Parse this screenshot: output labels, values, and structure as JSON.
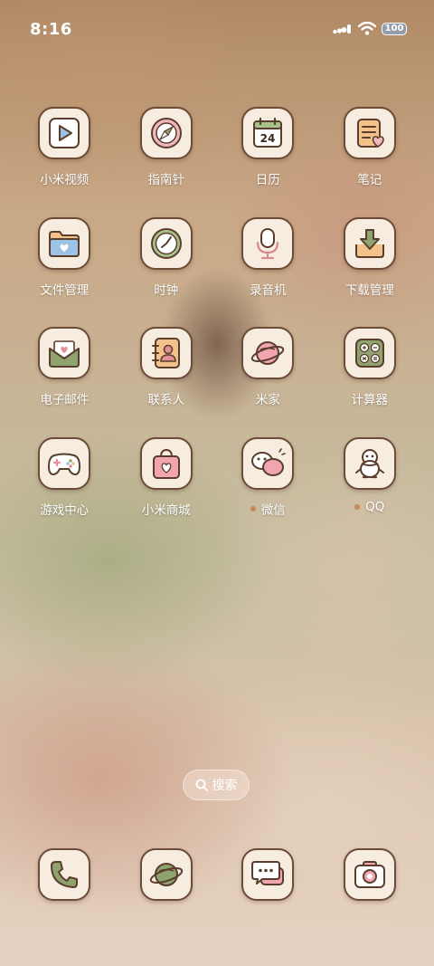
{
  "status_bar": {
    "time": "8:16",
    "signal_icon": "signal-bars-icon",
    "wifi_icon": "wifi-icon",
    "battery": "100"
  },
  "apps": [
    {
      "label": "小米视频",
      "icon": "video-play-icon"
    },
    {
      "label": "指南针",
      "icon": "compass-icon"
    },
    {
      "label": "日历",
      "icon": "calendar-icon",
      "day": "24"
    },
    {
      "label": "笔记",
      "icon": "notes-icon"
    },
    {
      "label": "文件管理",
      "icon": "folder-icon"
    },
    {
      "label": "时钟",
      "icon": "clock-icon"
    },
    {
      "label": "录音机",
      "icon": "microphone-icon"
    },
    {
      "label": "下载管理",
      "icon": "download-icon"
    },
    {
      "label": "电子邮件",
      "icon": "mail-icon"
    },
    {
      "label": "联系人",
      "icon": "contacts-icon"
    },
    {
      "label": "米家",
      "icon": "planet-icon"
    },
    {
      "label": "计算器",
      "icon": "calculator-icon"
    },
    {
      "label": "游戏中心",
      "icon": "gamepad-icon"
    },
    {
      "label": "小米商城",
      "icon": "shopping-bag-icon"
    },
    {
      "label": "微信",
      "icon": "chat-bubbles-icon",
      "new_dot": true
    },
    {
      "label": "QQ",
      "icon": "penguin-icon",
      "new_dot": true
    }
  ],
  "search": {
    "label": "搜索",
    "icon": "search-icon"
  },
  "dock": [
    {
      "icon": "phone-icon"
    },
    {
      "icon": "browser-planet-icon"
    },
    {
      "icon": "messages-icon"
    },
    {
      "icon": "camera-icon"
    }
  ],
  "colors": {
    "tile_bg": "#f6ede0",
    "tile_border": "#6c4b37",
    "notification_dot": "#c8875a",
    "label_text": "#ffffff"
  }
}
